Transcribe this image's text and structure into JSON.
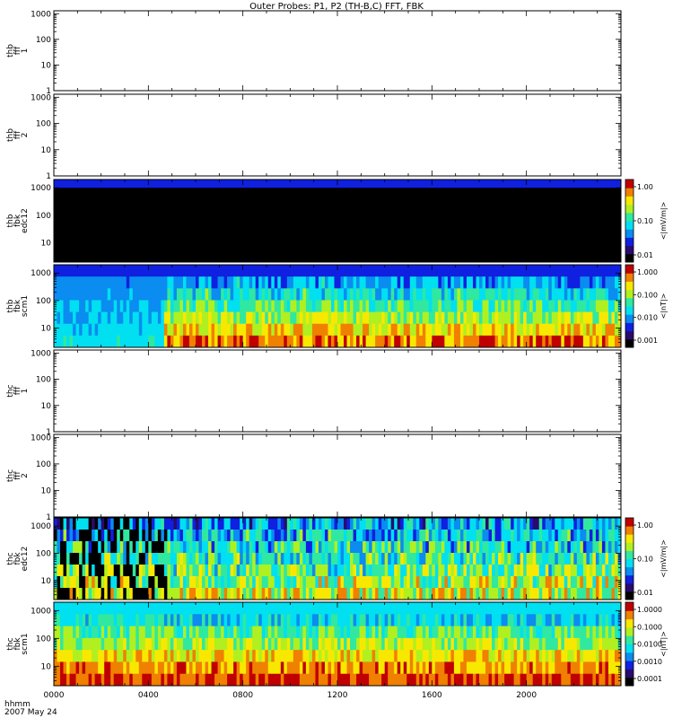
{
  "chart_data": {
    "type": "heatmap",
    "title": "Outer Probes: P1, P2 (TH-B,C) FFT, FBK",
    "x": {
      "start_hhmm": "0000",
      "end_hhmm": "2400",
      "tick_labels": [
        "0000",
        "0400",
        "0800",
        "1200",
        "1600",
        "2000"
      ],
      "time_label": "hhmm",
      "date_label": "2007 May 24"
    },
    "panels": [
      {
        "ylabel": [
          "thb",
          "fff",
          "1"
        ],
        "ytick_labels": [
          "1",
          "10",
          "100",
          "1000"
        ],
        "ylim": [
          1,
          1300
        ],
        "log": true,
        "data": "none"
      },
      {
        "ylabel": [
          "thb",
          "fff",
          "2"
        ],
        "ytick_labels": [
          "1",
          "10",
          "100",
          "1000"
        ],
        "ylim": [
          1,
          1300
        ],
        "log": true,
        "data": "none"
      },
      {
        "ylabel": [
          "thb",
          "fbk",
          "edc12"
        ],
        "ytick_labels": [
          "10",
          "100",
          "1000"
        ],
        "ylim": [
          2,
          2000
        ],
        "log": true,
        "data": "black_fill",
        "colorbar": {
          "label": "<|mV/m|>",
          "tick_labels": [
            "1.00",
            "0.10",
            "0.01"
          ]
        }
      },
      {
        "ylabel": [
          "thb",
          "fbk",
          "scm1"
        ],
        "ytick_labels": [
          "10",
          "100",
          "1000"
        ],
        "ylim": [
          2,
          2000
        ],
        "log": true,
        "data": "spectrogram",
        "colorbar": {
          "label": "<|nT|>",
          "tick_labels": [
            "1.000",
            "0.100",
            "0.010",
            "0.001"
          ]
        }
      },
      {
        "ylabel": [
          "thc",
          "fff",
          "1"
        ],
        "ytick_labels": [
          "1",
          "10",
          "100",
          "1000"
        ],
        "ylim": [
          1,
          1300
        ],
        "log": true,
        "data": "none"
      },
      {
        "ylabel": [
          "thc",
          "fff",
          "2"
        ],
        "ytick_labels": [
          "1",
          "10",
          "100",
          "1000"
        ],
        "ylim": [
          1,
          1300
        ],
        "log": true,
        "data": "none"
      },
      {
        "ylabel": [
          "thc",
          "fbk",
          "edc12"
        ],
        "ytick_labels": [
          "10",
          "100",
          "1000"
        ],
        "ylim": [
          2,
          2000
        ],
        "log": true,
        "data": "spectrogram",
        "colorbar": {
          "label": "<|mV/m|>",
          "tick_labels": [
            "1.00",
            "0.10",
            "0.01"
          ]
        }
      },
      {
        "ylabel": [
          "thc",
          "fbk",
          "scm1"
        ],
        "ytick_labels": [
          "10",
          "100",
          "1000"
        ],
        "ylim": [
          2,
          2000
        ],
        "log": true,
        "data": "spectrogram",
        "colorbar": {
          "label": "<|nT|>",
          "tick_labels": [
            "1.0000",
            "0.1000",
            "0.0100",
            "0.0010",
            "0.0001"
          ]
        }
      }
    ],
    "colormap": [
      "#000000",
      "#2a0a6e",
      "#1020e0",
      "#0a8cf0",
      "#00e0f0",
      "#30e8a0",
      "#b0f020",
      "#f8e800",
      "#f08000",
      "#c00000"
    ]
  }
}
